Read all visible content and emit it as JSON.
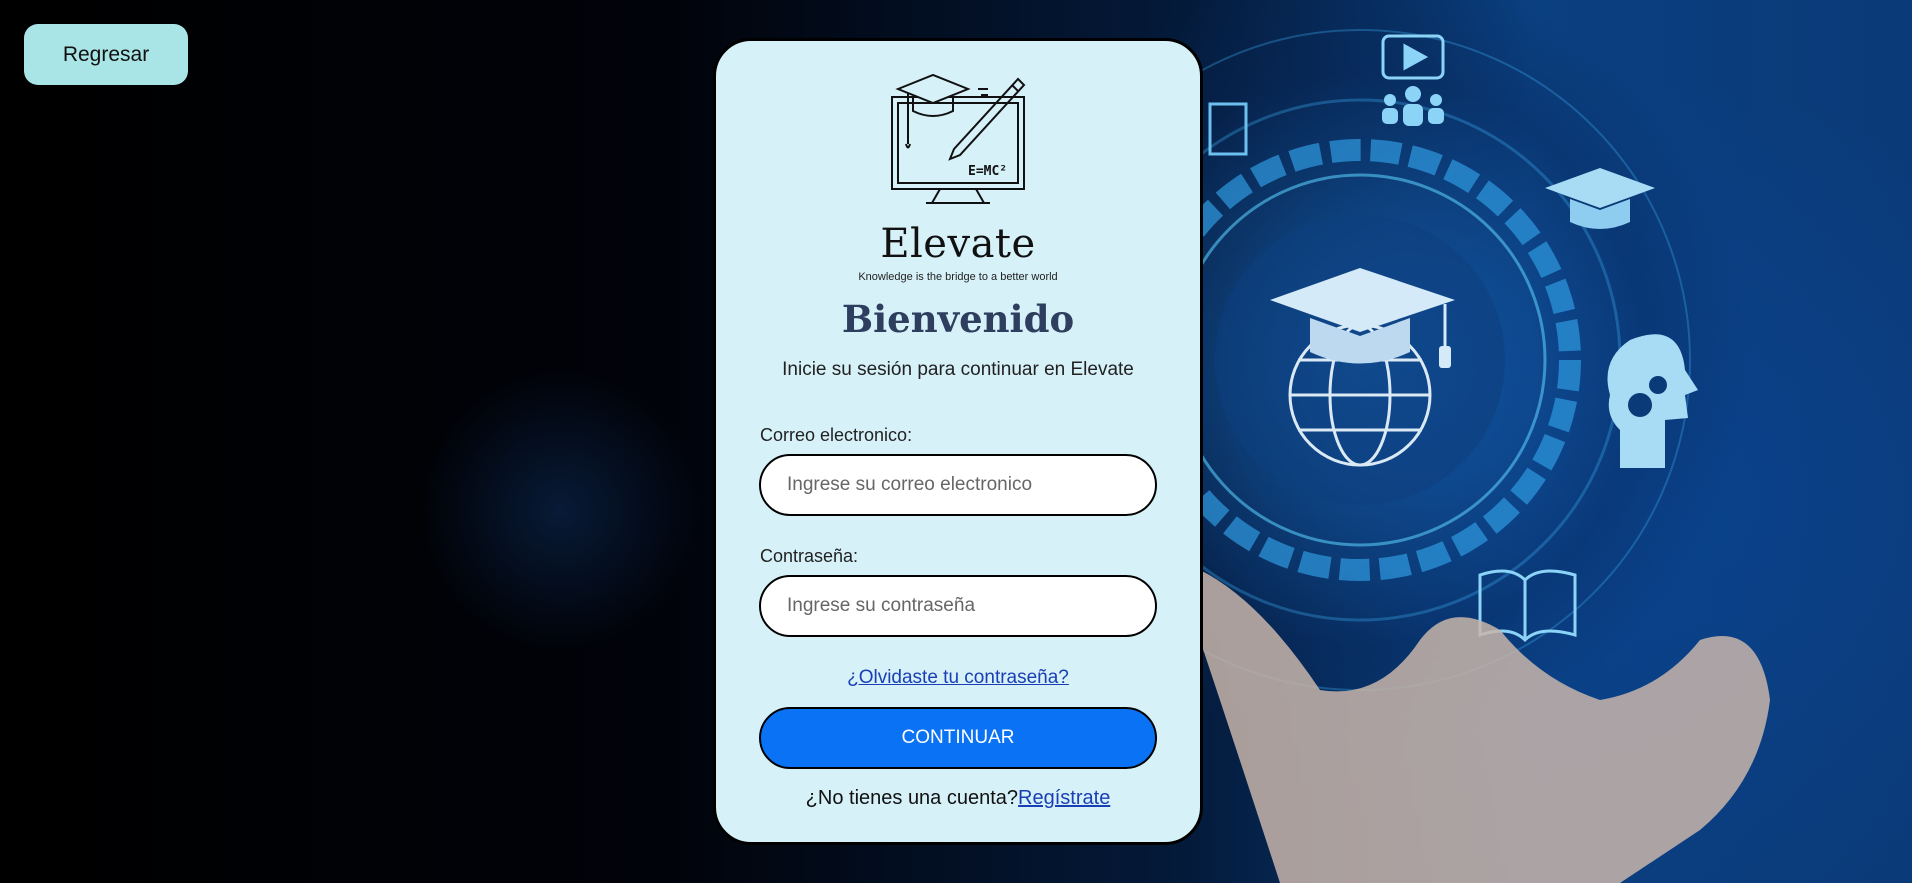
{
  "nav": {
    "back_label": "Regresar"
  },
  "brand": {
    "name": "Elevate",
    "tagline": "Knowledge is the bridge to a better world",
    "logo_formula": "E=MC²"
  },
  "login": {
    "welcome": "Bienvenido",
    "subtitle": "Inicie su sesión para continuar en Elevate",
    "email_label": "Correo electronico:",
    "email_placeholder": "Ingrese su correo electronico",
    "password_label": "Contraseña:",
    "password_placeholder": "Ingrese su contraseña",
    "forgot_label": "¿Olvidaste tu contraseña?",
    "continue_label": "CONTINUAR",
    "no_account_text": "¿No tienes una cuenta?",
    "signup_label": "Regístrate"
  },
  "colors": {
    "card_bg": "#d6f1f8",
    "back_button": "#a9e4e6",
    "primary_button": "#0a72f5",
    "heading": "#2d3e5e",
    "link": "#1a3fb5"
  }
}
